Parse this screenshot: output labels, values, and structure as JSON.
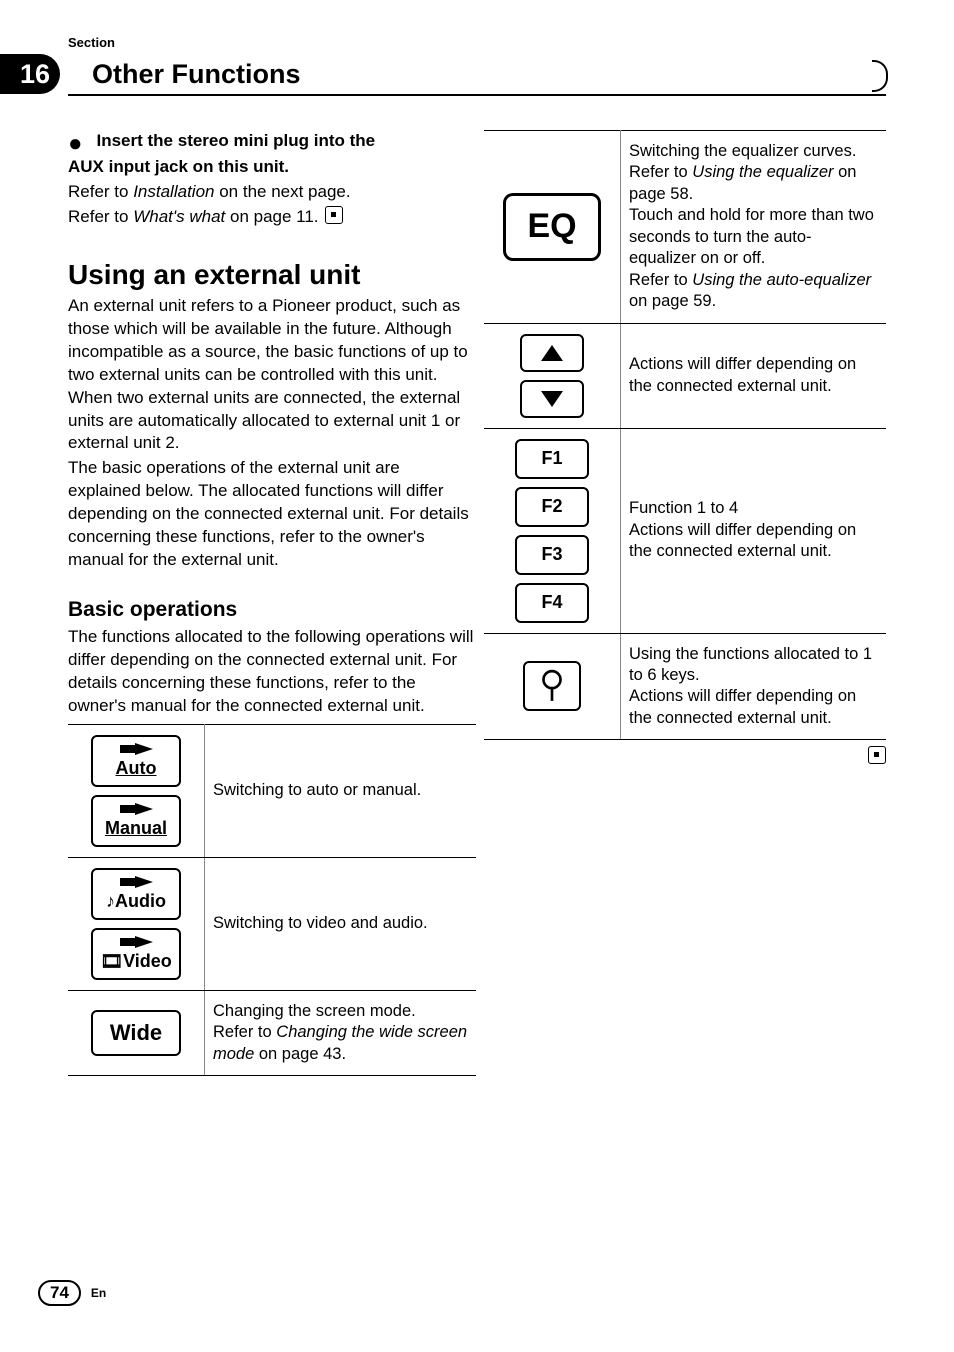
{
  "header": {
    "section_label": "Section",
    "chapter_number": "16",
    "chapter_title": "Other Functions"
  },
  "left": {
    "step_line1": "Insert the stereo mini plug into the",
    "step_line2": "AUX input jack on this unit.",
    "ref1_a": "Refer to ",
    "ref1_b": "Installation",
    "ref1_c": " on the next page.",
    "ref2_a": "Refer to ",
    "ref2_b": "What's what",
    "ref2_c": " on page 11.",
    "h1": "Using an external unit",
    "p1": "An external unit refers to a Pioneer product, such as those which will be available in the future. Although incompatible as a source, the basic functions of up to two external units can be controlled with this unit. When two external units are connected, the external units are automatically allocated to external unit 1 or external unit 2.",
    "p2": "The basic operations of the external unit are explained below. The allocated functions will differ depending on the connected external unit. For details concerning these functions, refer to the owner's manual for the external unit.",
    "h2": "Basic operations",
    "p3": "The functions allocated to the following operations will differ depending on the connected external unit. For details concerning these functions, refer to the owner's manual for the connected external unit.",
    "tbl": {
      "row1": {
        "icon1": "Auto",
        "icon2": "Manual",
        "desc": "Switching to auto or manual."
      },
      "row2": {
        "icon1": "Audio",
        "icon2": "Video",
        "desc": "Switching to video and audio."
      },
      "row3": {
        "icon": "Wide",
        "desc_a": "Changing the screen mode.",
        "desc_b": "Refer to ",
        "desc_c": "Changing the wide screen mode",
        "desc_d": " on page 43."
      }
    }
  },
  "right": {
    "tbl": {
      "row1": {
        "icon": "EQ",
        "d1": "Switching the equalizer curves.",
        "d2a": "Refer to ",
        "d2b": "Using the equalizer",
        "d2c": " on page 58.",
        "d3": "Touch and hold for more than two seconds to turn the auto-equalizer on or off.",
        "d4a": "Refer to ",
        "d4b": "Using the auto-equalizer",
        "d4c": " on page 59."
      },
      "row2": {
        "desc": "Actions will differ depending on the connected external unit."
      },
      "row3": {
        "f1": "F1",
        "f2": "F2",
        "f3": "F3",
        "f4": "F4",
        "d1": "Function 1 to 4",
        "d2": "Actions will differ depending on the connected external unit."
      },
      "row4": {
        "d1": "Using the functions allocated to 1 to 6 keys.",
        "d2": "Actions will differ depending on the connected external unit."
      }
    }
  },
  "footer": {
    "page": "74",
    "lang": "En"
  }
}
